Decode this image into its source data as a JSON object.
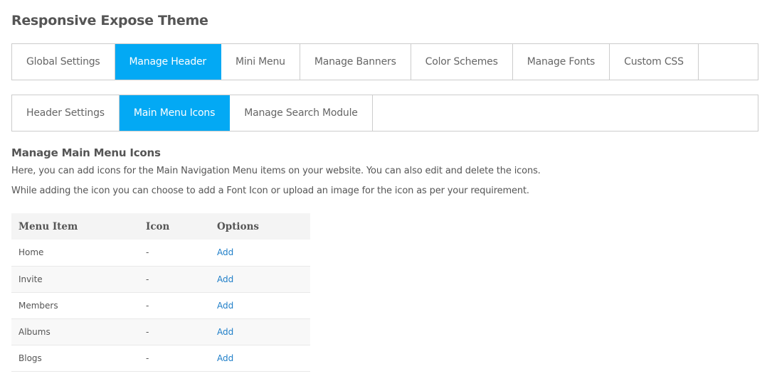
{
  "page_title": "Responsive Expose Theme",
  "main_tabs": [
    {
      "label": "Global Settings",
      "active": false
    },
    {
      "label": "Manage Header",
      "active": true
    },
    {
      "label": "Mini Menu",
      "active": false
    },
    {
      "label": "Manage Banners",
      "active": false
    },
    {
      "label": "Color Schemes",
      "active": false
    },
    {
      "label": "Manage Fonts",
      "active": false
    },
    {
      "label": "Custom CSS",
      "active": false
    }
  ],
  "sub_tabs": [
    {
      "label": "Header Settings",
      "active": false
    },
    {
      "label": "Main Menu Icons",
      "active": true
    },
    {
      "label": "Manage Search Module",
      "active": false
    }
  ],
  "section": {
    "title": "Manage Main Menu Icons",
    "description_1": "Here, you can add icons for the Main Navigation Menu items on your website. You can also edit and delete the icons.",
    "description_2": "While adding the icon you can choose to add a Font Icon or upload an image for the icon as per your requirement."
  },
  "table": {
    "headers": [
      "Menu Item",
      "Icon",
      "Options"
    ],
    "rows": [
      {
        "menu_item": "Home",
        "icon": "-",
        "option": "Add"
      },
      {
        "menu_item": "Invite",
        "icon": "-",
        "option": "Add"
      },
      {
        "menu_item": "Members",
        "icon": "-",
        "option": "Add"
      },
      {
        "menu_item": "Albums",
        "icon": "-",
        "option": "Add"
      },
      {
        "menu_item": "Blogs",
        "icon": "-",
        "option": "Add"
      }
    ]
  },
  "colors": {
    "accent": "#03a9f4",
    "link": "#1e7ec8",
    "border": "#cccccc"
  }
}
